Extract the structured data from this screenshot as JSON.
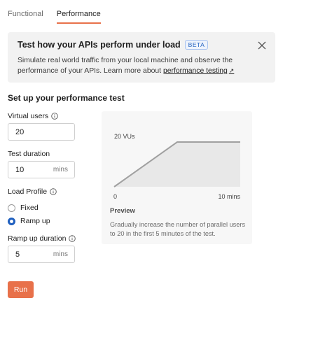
{
  "tabs": [
    {
      "label": "Functional",
      "active": false
    },
    {
      "label": "Performance",
      "active": true
    }
  ],
  "banner": {
    "title": "Test how your APIs perform under load",
    "badge": "BETA",
    "text_before_link": "Simulate real world traffic from your local machine and observe the performance of your APIs. Learn more about ",
    "link_text": "performance testing",
    "link_arrow": "↗"
  },
  "section_title": "Set up your performance test",
  "virtual_users": {
    "label": "Virtual users",
    "value": "20"
  },
  "test_duration": {
    "label": "Test duration",
    "value": "10",
    "unit": "mins"
  },
  "load_profile": {
    "label": "Load Profile",
    "options": [
      {
        "label": "Fixed",
        "checked": false
      },
      {
        "label": "Ramp up",
        "checked": true
      }
    ]
  },
  "ramp_up_duration": {
    "label": "Ramp up duration",
    "value": "5",
    "unit": "mins"
  },
  "run_button": "Run",
  "preview": {
    "title": "Preview",
    "description": "Gradually increase the number of parallel users to 20 in the first 5 minutes of the test.",
    "chart_data": {
      "type": "area",
      "x": [
        0,
        5,
        10
      ],
      "y": [
        0,
        20,
        20
      ],
      "xlim": [
        0,
        10
      ],
      "ylim": [
        0,
        20
      ],
      "x_start_label": "0",
      "x_end_label": "10 mins",
      "y_label": "20 VUs",
      "line_color": "#a0a0a0",
      "fill_color": "#e8e8e8"
    }
  },
  "colors": {
    "accent": "#e8714a",
    "radio_checked": "#1f5fbf"
  }
}
